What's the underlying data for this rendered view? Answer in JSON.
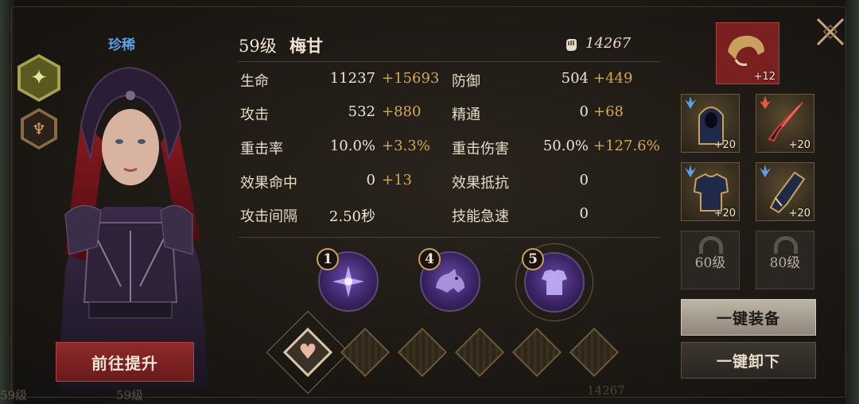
{
  "hero": {
    "rarity": "珍稀",
    "level": "59级",
    "name": "梅甘",
    "power": "14267"
  },
  "stats": [
    {
      "label": "生命",
      "base": "11237",
      "bonus": "+15693"
    },
    {
      "label": "防御",
      "base": "504",
      "bonus": "+449"
    },
    {
      "label": "攻击",
      "base": "532",
      "bonus": "+880"
    },
    {
      "label": "精通",
      "base": "0",
      "bonus": "+68"
    },
    {
      "label": "重击率",
      "base": "10.0%",
      "bonus": "+3.3%"
    },
    {
      "label": "重击伤害",
      "base": "50.0%",
      "bonus": "+127.6%"
    },
    {
      "label": "效果命中",
      "base": "0",
      "bonus": "+13"
    },
    {
      "label": "效果抵抗",
      "base": "0",
      "bonus": ""
    },
    {
      "label": "攻击间隔",
      "base": "2.50秒",
      "bonus": ""
    },
    {
      "label": "技能急速",
      "base": "0",
      "bonus": ""
    }
  ],
  "skills": [
    {
      "number": "1",
      "icon": "star-burst-icon"
    },
    {
      "number": "4",
      "icon": "beast-icon"
    },
    {
      "number": "5",
      "icon": "armor-icon"
    }
  ],
  "buttons": {
    "upgrade": "前往提升",
    "equip_all": "一键装备",
    "unequip_all": "一键卸下"
  },
  "equipment": {
    "top": {
      "level": "+12",
      "icon": "horn-icon"
    },
    "slots": [
      {
        "level": "+20",
        "icon": "hood-icon"
      },
      {
        "level": "+20",
        "icon": "dagger-icon"
      },
      {
        "level": "+20",
        "icon": "chest-armor-icon"
      },
      {
        "level": "+20",
        "icon": "gauntlet-icon"
      }
    ],
    "locked": [
      {
        "level": "60级"
      },
      {
        "level": "80级"
      }
    ]
  },
  "background_text": {
    "left_level": "59级",
    "left_level2": "59级",
    "right_power": "14267"
  },
  "colors": {
    "rarity": "#5aa2e8",
    "bonus": "#d4a94e",
    "upgrade_button": "#8e2a2a",
    "skill_orb": "#3c2466"
  }
}
